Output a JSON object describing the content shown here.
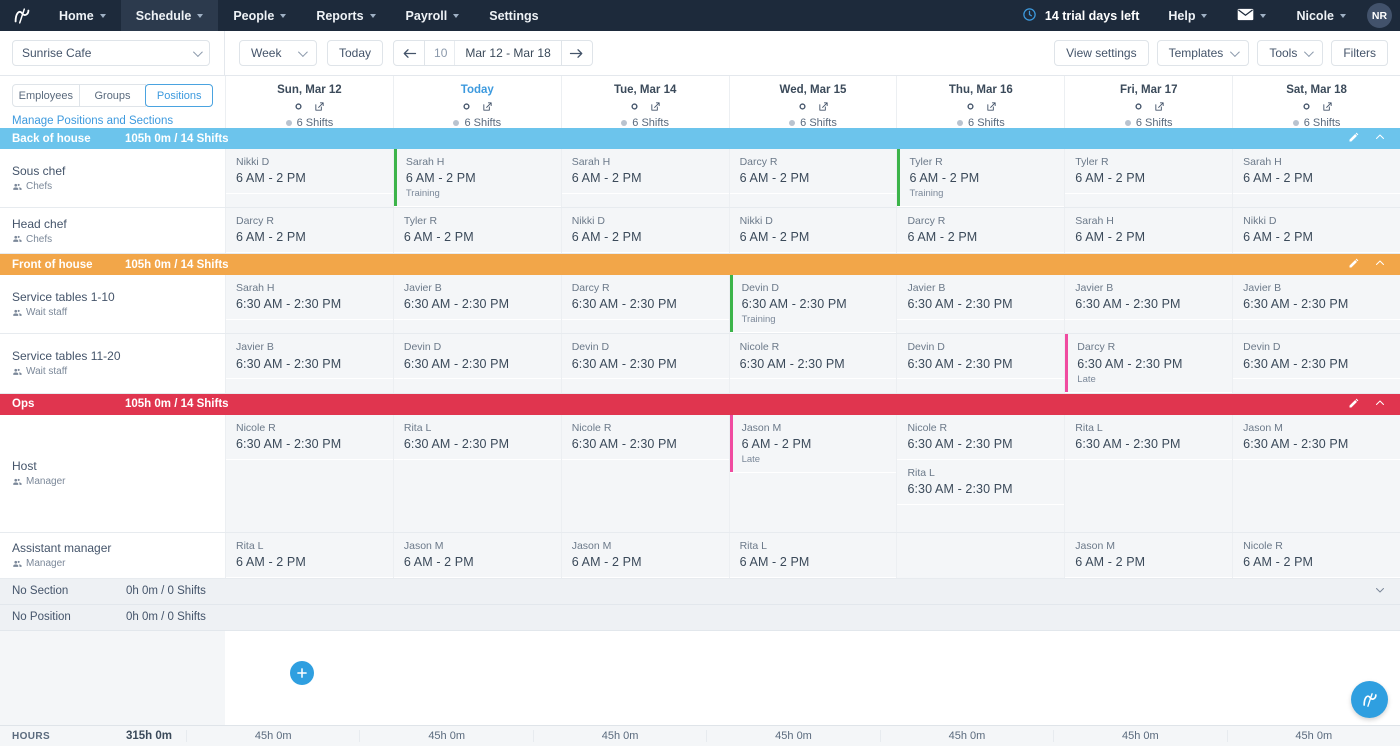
{
  "nav": {
    "logo_icon": "humanity-logo-icon",
    "items": [
      {
        "label": "Home",
        "caret": true,
        "active": false
      },
      {
        "label": "Schedule",
        "caret": true,
        "active": true
      },
      {
        "label": "People",
        "caret": true,
        "active": false
      },
      {
        "label": "Reports",
        "caret": true,
        "active": false
      },
      {
        "label": "Payroll",
        "caret": true,
        "active": false
      },
      {
        "label": "Settings",
        "caret": false,
        "active": false
      }
    ],
    "trial": {
      "icon": "clock-icon",
      "text": "14 trial days left"
    },
    "help_label": "Help",
    "mail_icon": "envelope-icon",
    "user_label": "Nicole",
    "avatar_initials": "NR"
  },
  "toolbar": {
    "site": "Sunrise Cafe",
    "view_period": "Week",
    "today_label": "Today",
    "week_number": "10",
    "date_range": "Mar 12 - Mar 18",
    "prev_icon": "arrow-left-icon",
    "next_icon": "arrow-right-icon",
    "view_settings_label": "View settings",
    "templates_label": "Templates",
    "tools_label": "Tools",
    "filters_label": "Filters"
  },
  "viewbar": {
    "segments": [
      {
        "label": "Employees",
        "active": false
      },
      {
        "label": "Groups",
        "active": false
      },
      {
        "label": "Positions",
        "active": true
      }
    ],
    "manage_link": "Manage Positions and Sections"
  },
  "days": [
    {
      "title": "Sun, Mar 12",
      "today": false,
      "shifts": "6 Shifts"
    },
    {
      "title": "Today",
      "today": true,
      "shifts": "6 Shifts"
    },
    {
      "title": "Tue, Mar 14",
      "today": false,
      "shifts": "6 Shifts"
    },
    {
      "title": "Wed, Mar 15",
      "today": false,
      "shifts": "6 Shifts"
    },
    {
      "title": "Thu, Mar 16",
      "today": false,
      "shifts": "6 Shifts"
    },
    {
      "title": "Fri, Mar 17",
      "today": false,
      "shifts": "6 Shifts"
    },
    {
      "title": "Sat, Mar 18",
      "today": false,
      "shifts": "6 Shifts"
    }
  ],
  "colors": {
    "back_of_house": "#6cc4ec",
    "front_of_house": "#f2a649",
    "ops": "#e0354f",
    "training_flag": "#3cb44a",
    "late_flag": "#f04ba0",
    "accent": "#3d9ade",
    "nav_bg": "#1d2a3b"
  },
  "sections": [
    {
      "name": "Back of house",
      "stats": "105h 0m / 14 Shifts",
      "color_key": "back_of_house",
      "rows": [
        {
          "position": "Sous chef",
          "group": "Chefs",
          "cells": [
            [
              {
                "employee": "Nikki D",
                "time": "6 AM  - 2 PM"
              }
            ],
            [
              {
                "employee": "Sarah H",
                "time": "6 AM  - 2 PM",
                "tag": "Training",
                "flag": "training"
              }
            ],
            [
              {
                "employee": "Sarah H",
                "time": "6 AM  - 2 PM"
              }
            ],
            [
              {
                "employee": "Darcy R",
                "time": "6 AM  - 2 PM"
              }
            ],
            [
              {
                "employee": "Tyler R",
                "time": "6 AM  - 2 PM",
                "tag": "Training",
                "flag": "training"
              }
            ],
            [
              {
                "employee": "Tyler R",
                "time": "6 AM  - 2 PM"
              }
            ],
            [
              {
                "employee": "Sarah H",
                "time": "6 AM  - 2 PM"
              }
            ]
          ]
        },
        {
          "position": "Head chef",
          "group": "Chefs",
          "cells": [
            [
              {
                "employee": "Darcy R",
                "time": "6 AM  - 2 PM"
              }
            ],
            [
              {
                "employee": "Tyler R",
                "time": "6 AM  - 2 PM"
              }
            ],
            [
              {
                "employee": "Nikki D",
                "time": "6 AM  - 2 PM"
              }
            ],
            [
              {
                "employee": "Nikki D",
                "time": "6 AM  - 2 PM"
              }
            ],
            [
              {
                "employee": "Darcy R",
                "time": "6 AM  - 2 PM"
              }
            ],
            [
              {
                "employee": "Sarah H",
                "time": "6 AM  - 2 PM"
              }
            ],
            [
              {
                "employee": "Nikki D",
                "time": "6 AM  - 2 PM"
              }
            ]
          ]
        }
      ]
    },
    {
      "name": "Front of house",
      "stats": "105h 0m / 14 Shifts",
      "color_key": "front_of_house",
      "rows": [
        {
          "position": "Service tables 1-10",
          "group": "Wait staff",
          "cells": [
            [
              {
                "employee": "Sarah H",
                "time": "6:30 AM  - 2:30 PM"
              }
            ],
            [
              {
                "employee": "Javier B",
                "time": "6:30 AM  - 2:30 PM"
              }
            ],
            [
              {
                "employee": "Darcy R",
                "time": "6:30 AM  - 2:30 PM"
              }
            ],
            [
              {
                "employee": "Devin D",
                "time": "6:30 AM  - 2:30 PM",
                "tag": "Training",
                "flag": "training"
              }
            ],
            [
              {
                "employee": "Javier B",
                "time": "6:30 AM  - 2:30 PM"
              }
            ],
            [
              {
                "employee": "Javier B",
                "time": "6:30 AM  - 2:30 PM"
              }
            ],
            [
              {
                "employee": "Javier B",
                "time": "6:30 AM  - 2:30 PM"
              }
            ]
          ]
        },
        {
          "position": "Service tables 11-20",
          "group": "Wait staff",
          "cells": [
            [
              {
                "employee": "Javier B",
                "time": "6:30 AM  - 2:30 PM"
              }
            ],
            [
              {
                "employee": "Devin D",
                "time": "6:30 AM  - 2:30 PM"
              }
            ],
            [
              {
                "employee": "Devin D",
                "time": "6:30 AM  - 2:30 PM"
              }
            ],
            [
              {
                "employee": "Nicole R",
                "time": "6:30 AM  - 2:30 PM"
              }
            ],
            [
              {
                "employee": "Devin D",
                "time": "6:30 AM  - 2:30 PM"
              }
            ],
            [
              {
                "employee": "Darcy R",
                "time": "6:30 AM  - 2:30 PM",
                "tag": "Late",
                "flag": "late"
              }
            ],
            [
              {
                "employee": "Devin D",
                "time": "6:30 AM  - 2:30 PM"
              }
            ]
          ]
        }
      ]
    },
    {
      "name": "Ops",
      "stats": "105h 0m / 14 Shifts",
      "color_key": "ops",
      "rows": [
        {
          "position": "Host",
          "group": "Manager",
          "tall": true,
          "cells": [
            [
              {
                "employee": "Nicole R",
                "time": "6:30 AM  - 2:30 PM"
              }
            ],
            [
              {
                "employee": "Rita L",
                "time": "6:30 AM  - 2:30 PM"
              }
            ],
            [
              {
                "employee": "Nicole R",
                "time": "6:30 AM  - 2:30 PM"
              }
            ],
            [
              {
                "employee": "Jason M",
                "time": "6 AM  - 2 PM",
                "tag": "Late",
                "flag": "late"
              }
            ],
            [
              {
                "employee": "Nicole R",
                "time": "6:30 AM  - 2:30 PM"
              },
              {
                "employee": "Rita L",
                "time": "6:30 AM  - 2:30 PM"
              }
            ],
            [
              {
                "employee": "Rita L",
                "time": "6:30 AM  - 2:30 PM"
              }
            ],
            [
              {
                "employee": "Jason M",
                "time": "6:30 AM  - 2:30 PM"
              }
            ]
          ]
        },
        {
          "position": "Assistant manager",
          "group": "Manager",
          "cells": [
            [
              {
                "employee": "Rita L",
                "time": "6 AM  - 2 PM"
              }
            ],
            [
              {
                "employee": "Jason M",
                "time": "6 AM  - 2 PM"
              }
            ],
            [
              {
                "employee": "Jason M",
                "time": "6 AM  - 2 PM"
              }
            ],
            [
              {
                "employee": "Rita L",
                "time": "6 AM  - 2 PM"
              }
            ],
            [],
            [
              {
                "employee": "Jason M",
                "time": "6 AM  - 2 PM"
              }
            ],
            [
              {
                "employee": "Nicole R",
                "time": "6 AM  - 2 PM"
              }
            ]
          ]
        }
      ]
    }
  ],
  "empty_rows": [
    {
      "name": "No Section",
      "stats": "0h 0m / 0 Shifts"
    },
    {
      "name": "No Position",
      "stats": "0h 0m / 0 Shifts"
    }
  ],
  "add_shift_icon": "plus-icon",
  "hours_footer": {
    "label": "HOURS",
    "total": "315h 0m",
    "days": [
      "45h 0m",
      "45h 0m",
      "45h 0m",
      "45h 0m",
      "45h 0m",
      "45h 0m",
      "45h 0m"
    ]
  },
  "fab_icon": "humanity-logo-icon"
}
